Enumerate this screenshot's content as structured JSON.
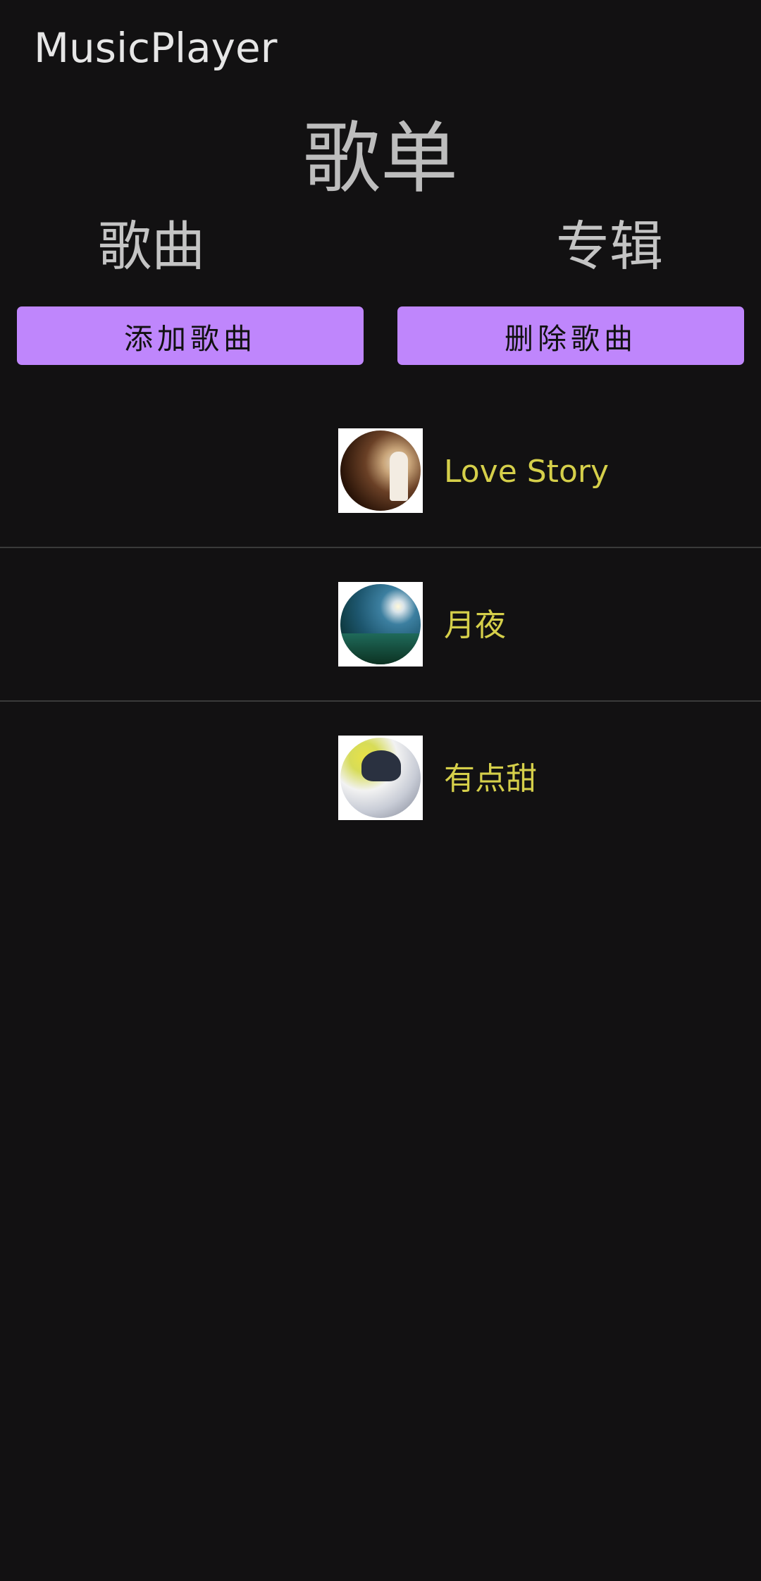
{
  "app": {
    "title": "MusicPlayer"
  },
  "heading": "歌单",
  "tabs": {
    "songs": "歌曲",
    "albums": "专辑"
  },
  "buttons": {
    "add": "添加歌曲",
    "delete": "删除歌曲"
  },
  "songs": [
    {
      "title": "Love Story"
    },
    {
      "title": "月夜"
    },
    {
      "title": "有点甜"
    }
  ],
  "colors": {
    "background": "#121112",
    "button": "#bf86fc",
    "song_title": "#d5cf4a"
  }
}
